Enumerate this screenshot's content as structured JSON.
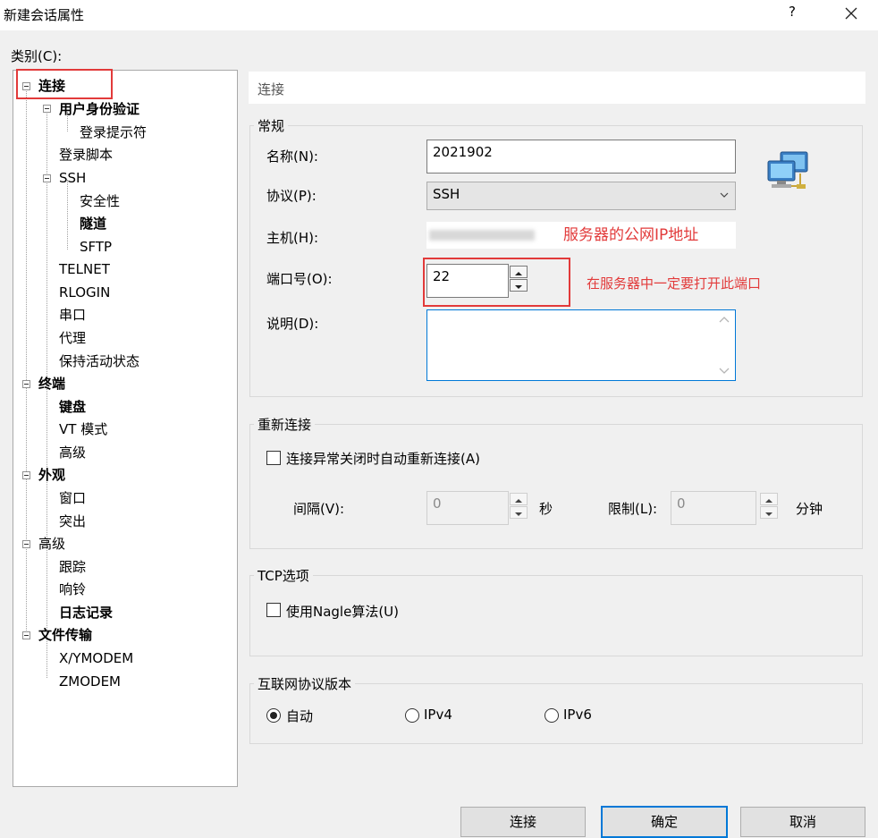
{
  "window": {
    "title": "新建会话属性",
    "help": "?",
    "close_icon": "close-icon"
  },
  "category_label": "类别(C):",
  "tree": {
    "items": [
      {
        "label": "连接",
        "bold": true
      },
      {
        "label": "用户身份验证",
        "bold": true
      },
      {
        "label": "登录提示符",
        "bold": false
      },
      {
        "label": "登录脚本",
        "bold": false
      },
      {
        "label": "SSH",
        "bold": false
      },
      {
        "label": "安全性",
        "bold": false
      },
      {
        "label": "隧道",
        "bold": true
      },
      {
        "label": "SFTP",
        "bold": false
      },
      {
        "label": "TELNET",
        "bold": false
      },
      {
        "label": "RLOGIN",
        "bold": false
      },
      {
        "label": "串口",
        "bold": false
      },
      {
        "label": "代理",
        "bold": false
      },
      {
        "label": "保持活动状态",
        "bold": false
      },
      {
        "label": "终端",
        "bold": true
      },
      {
        "label": "键盘",
        "bold": true
      },
      {
        "label": "VT 模式",
        "bold": false
      },
      {
        "label": "高级",
        "bold": false
      },
      {
        "label": "外观",
        "bold": true
      },
      {
        "label": "窗口",
        "bold": false
      },
      {
        "label": "突出",
        "bold": false
      },
      {
        "label": "高级",
        "bold": false
      },
      {
        "label": "跟踪",
        "bold": false
      },
      {
        "label": "响铃",
        "bold": false
      },
      {
        "label": "日志记录",
        "bold": true
      },
      {
        "label": "文件传输",
        "bold": true
      },
      {
        "label": "X/YMODEM",
        "bold": false
      },
      {
        "label": "ZMODEM",
        "bold": false
      }
    ]
  },
  "section_title": "连接",
  "general": {
    "title": "常规",
    "name_label": "名称(N):",
    "name_value": "2021902",
    "protocol_label": "协议(P):",
    "protocol_value": "SSH",
    "host_label": "主机(H):",
    "host_value": "",
    "host_annotation": "服务器的公网IP地址",
    "port_label": "端口号(O):",
    "port_value": "22",
    "port_annotation": "在服务器中一定要打开此端口",
    "desc_label": "说明(D):",
    "desc_value": ""
  },
  "reconnect": {
    "title": "重新连接",
    "checkbox_label": "连接异常关闭时自动重新连接(A)",
    "interval_label": "间隔(V):",
    "interval_value": "0",
    "interval_unit": "秒",
    "limit_label": "限制(L):",
    "limit_value": "0",
    "limit_unit": "分钟"
  },
  "tcp": {
    "title": "TCP选项",
    "nagle_label": "使用Nagle算法(U)"
  },
  "ip_version": {
    "title": "互联网协议版本",
    "auto_label": "自动",
    "ipv4_label": "IPv4",
    "ipv6_label": "IPv6",
    "selected": "自动"
  },
  "buttons": {
    "connect": "连接",
    "ok": "确定",
    "cancel": "取消"
  },
  "colors": {
    "annotation": "#e23a3a",
    "focus": "#0078d7"
  }
}
